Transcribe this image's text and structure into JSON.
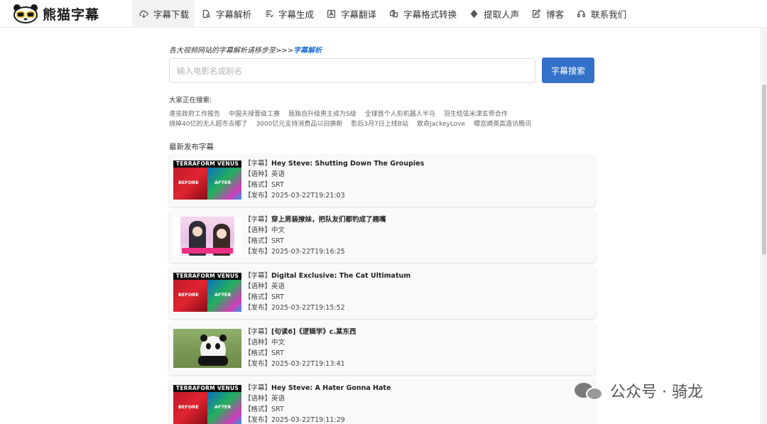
{
  "app": {
    "logo_text": "熊猫字幕"
  },
  "nav": {
    "items": [
      {
        "label": "字幕下载",
        "icon": "cloud-download-icon",
        "active": true
      },
      {
        "label": "字幕解析",
        "icon": "document-search-icon",
        "active": false
      },
      {
        "label": "字幕生成",
        "icon": "document-list-icon",
        "active": false
      },
      {
        "label": "字幕翻译",
        "icon": "translate-icon",
        "active": false
      },
      {
        "label": "字幕格式转换",
        "icon": "convert-icon",
        "active": false
      },
      {
        "label": "提取人声",
        "icon": "voice-icon",
        "active": false
      },
      {
        "label": "博客",
        "icon": "edit-icon",
        "active": false
      },
      {
        "label": "联系我们",
        "icon": "headset-icon",
        "active": false
      }
    ]
  },
  "search": {
    "hint_prefix": "各大视频网站的字幕解析请移步至>>>",
    "hint_link": "字幕解析",
    "placeholder": "输入电影名或剧名",
    "button_label": "字幕搜索"
  },
  "trending": {
    "title": "大家正在搜索:",
    "row1": [
      "速览政府工作报告",
      "中国天禄晋级工赛",
      "我独自升级男主成为S级",
      "全球首个人形机器人半马",
      "羽生结弦米津玄师合作"
    ],
    "row2": [
      "烧掉40亿的无人超市去哪了",
      "3000亿元支持消费品以旧换新",
      "影后3月7日上线B站",
      "致命JackeyLove",
      "曝宫崎英高造访腾讯"
    ]
  },
  "latest": {
    "title": "最新发布字幕",
    "field_labels": {
      "subtitle": "【字幕】",
      "language": "【语种】",
      "format": "【格式】",
      "published": "【发布】"
    },
    "thumb_text": {
      "header": "TERRAFORM VENUS",
      "before": "BEFORE",
      "after": "AFTER"
    },
    "items": [
      {
        "title": "Hey Steve: Shutting Down The Groupies",
        "language": "英语",
        "format": "SRT",
        "published": "2025-03-22T19:21:03",
        "thumb": "terraform"
      },
      {
        "title": "穿上男装撩妹，把队友们都钓成了翘嘴",
        "language": "中文",
        "format": "SRT",
        "published": "2025-03-22T19:16:25",
        "thumb": "anime"
      },
      {
        "title": "Digital Exclusive: The Cat Ultimatum",
        "language": "英语",
        "format": "SRT",
        "published": "2025-03-22T19:15:52",
        "thumb": "terraform"
      },
      {
        "title": "[句读6]《逻辑学》c.某东西",
        "language": "中文",
        "format": "SRT",
        "published": "2025-03-22T19:13:41",
        "thumb": "panda"
      },
      {
        "title": "Hey Steve: A Hater Gonna Hate",
        "language": "英语",
        "format": "SRT",
        "published": "2025-03-22T19:11:29",
        "thumb": "terraform"
      }
    ]
  },
  "watermark": {
    "text": "公众号 · 骑龙"
  },
  "colors": {
    "accent": "#3471c9",
    "link": "#1e6fd0",
    "card_bg": "#f8f9fb"
  }
}
